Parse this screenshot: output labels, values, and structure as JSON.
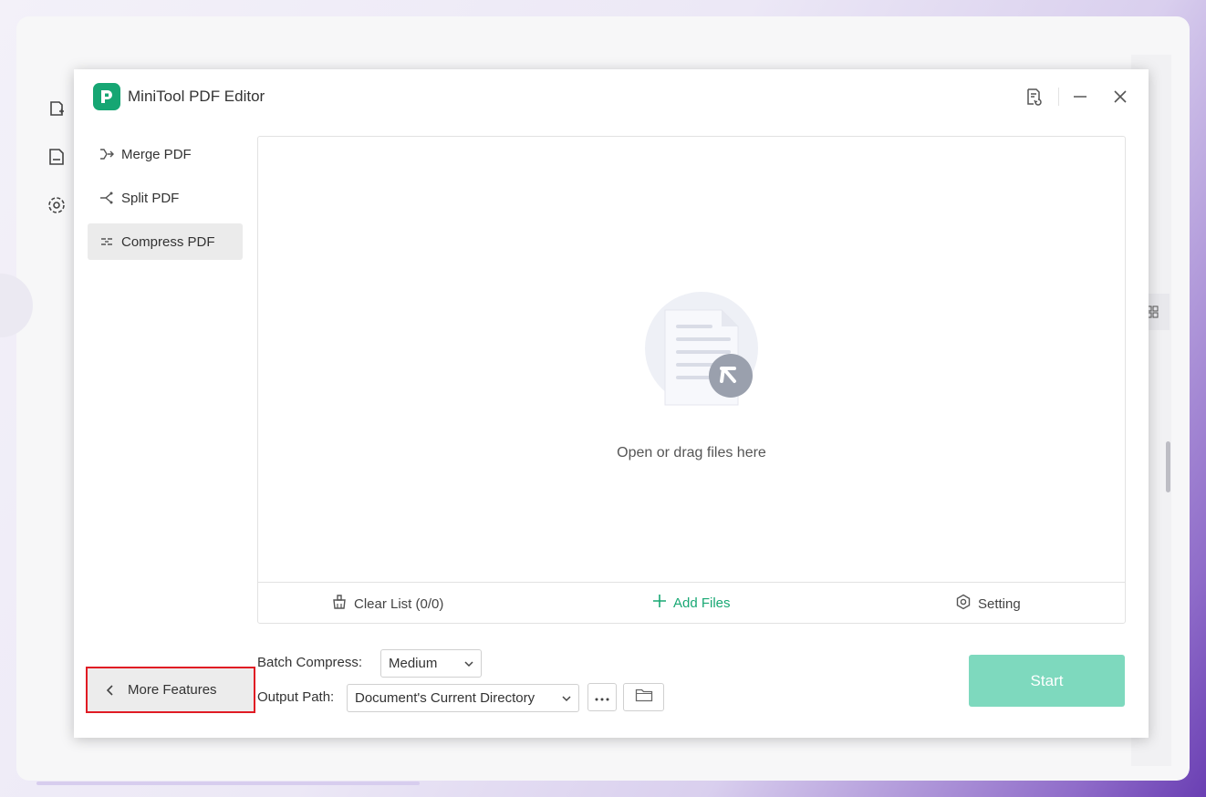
{
  "app": {
    "title": "MiniTool PDF Editor"
  },
  "sidebar": {
    "items": [
      {
        "label": "Merge PDF",
        "icon": "merge-icon",
        "active": false
      },
      {
        "label": "Split PDF",
        "icon": "split-icon",
        "active": false
      },
      {
        "label": "Compress PDF",
        "icon": "compress-icon",
        "active": true
      }
    ],
    "more_features": "More Features"
  },
  "drop_area": {
    "text": "Open or drag files here",
    "clear_list": "Clear List (0/0)",
    "add_files": "Add Files",
    "setting": "Setting"
  },
  "options": {
    "batch_label": "Batch Compress:",
    "batch_value": "Medium",
    "output_label": "Output Path:",
    "output_value": "Document's Current Directory"
  },
  "start": "Start",
  "colors": {
    "accent": "#19a874",
    "start_disabled": "#7ed9be",
    "highlight": "#e01b24"
  }
}
